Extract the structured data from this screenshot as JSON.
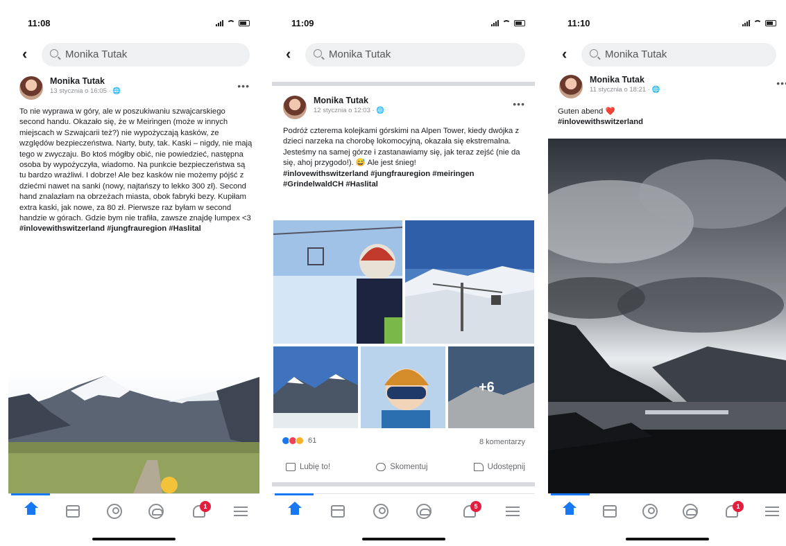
{
  "phones": [
    {
      "time": "11:08",
      "search": "Monika Tutak",
      "post": {
        "author": "Monika Tutak",
        "date": "13 stycznia o 16:05 · ",
        "text": "To nie wyprawa w góry, ale w poszukiwaniu szwajcarskiego second handu. Okazało się, że w Meiringen (może w innych miejscach w Szwajcarii też?) nie wypożyczają kasków, ze względów bezpieczeństwa. Narty, buty, tak. Kaski – nigdy, nie mają tego w zwyczaju. Bo ktoś mógłby obić, nie powiedzieć, następna osoba by wypożyczyła, wiadomo. Na punkcie bezpieczeństwa są tu bardzo wrażliwi. I dobrze! Ale bez kasków nie możemy pójść z dziećmi nawet na sanki (nowy, najtańszy to lekko 300 zł). Second hand znalazłam na obrzeżach miasta, obok fabryki bezy. Kupiłam extra kaski, jak nowe, za 80 zł. Pierwsze raz byłam w second handzie w górach. Gdzie bym nie trafiła, zawsze znajdę lumpex <3",
        "tags": "#inlovewithswitzerland #jungfrauregion #Haslital"
      },
      "notif_badge": "1"
    },
    {
      "time": "11:09",
      "search": "Monika Tutak",
      "post": {
        "author": "Monika Tutak",
        "date": "12 stycznia o 12:03 · ",
        "text": "Podróż czterema kolejkami górskimi na Alpen Tower, kiedy dwójka z dzieci narzeka na chorobę lokomocyjną, okazała się ekstremalna.  Jesteśmy na samej górze i zastanawiamy się, jak teraz zejść (nie da się, ahoj przygodo!). 😅 Ale jest śnieg!",
        "tags": "#inlovewithswitzerland #jungfrauregion #meiringen #GrindelwaldCH #Haslital",
        "more_photos": "+6",
        "reactions_count": "61",
        "comments": "8 komentarzy",
        "actions": [
          "Lubię to!",
          "Skomentuj",
          "Udostępnij"
        ]
      },
      "notif_badge": "5"
    },
    {
      "time": "11:10",
      "search": "Monika Tutak",
      "post": {
        "author": "Monika Tutak",
        "date": "11 stycznia o 18:21 · ",
        "text": "Guten abend ❤️",
        "tags": "#inlovewithswitzerland"
      },
      "notif_badge": "1"
    }
  ]
}
